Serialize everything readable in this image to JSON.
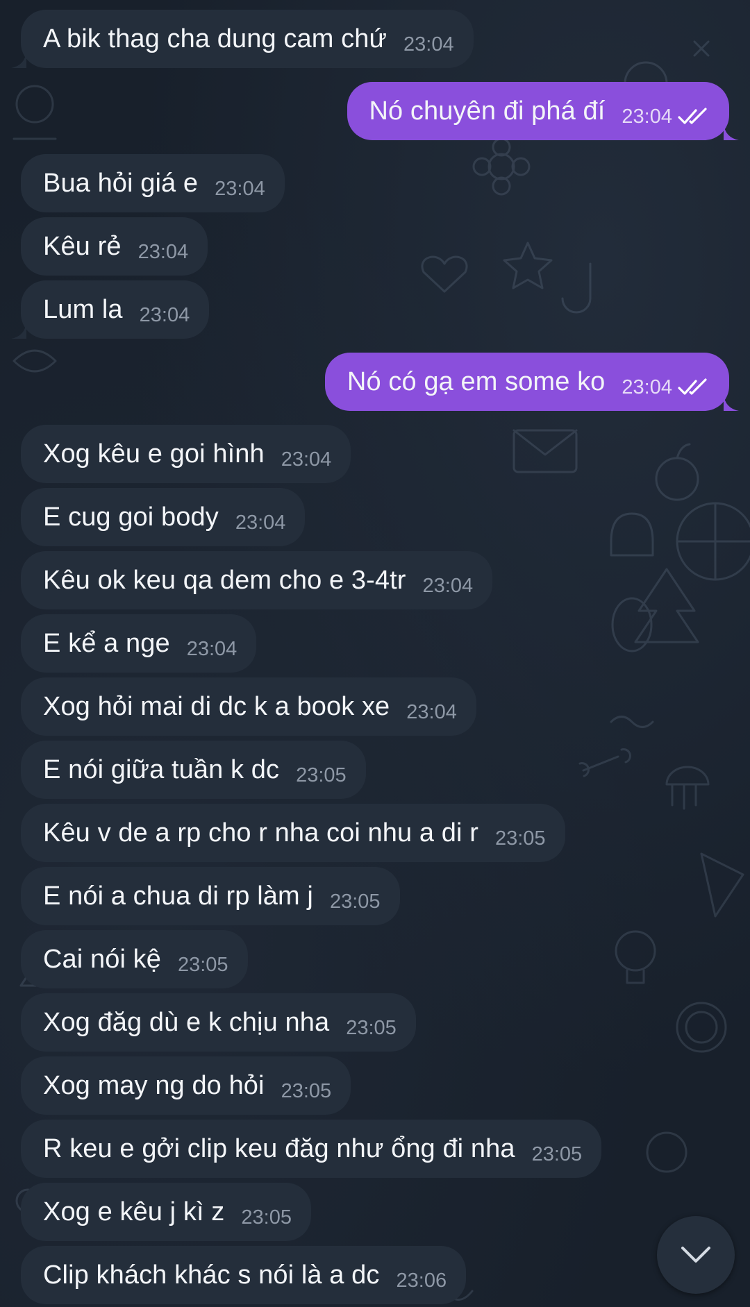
{
  "chat": {
    "messages": [
      {
        "dir": "in",
        "text": "A bik thag cha dung cam chứ",
        "time": "23:04",
        "tail": true
      },
      {
        "dir": "out",
        "text": "Nó chuyên đi phá đí",
        "time": "23:04",
        "read": true,
        "tail": true
      },
      {
        "dir": "in",
        "text": "Bua hỏi giá e",
        "time": "23:04",
        "tail": false
      },
      {
        "dir": "in",
        "text": "Kêu rẻ",
        "time": "23:04",
        "tail": false
      },
      {
        "dir": "in",
        "text": "Lum la",
        "time": "23:04",
        "tail": true
      },
      {
        "dir": "out",
        "text": "Nó có gạ em some ko",
        "time": "23:04",
        "read": true,
        "tail": true
      },
      {
        "dir": "in",
        "text": "Xog kêu e goi hình",
        "time": "23:04",
        "tail": false
      },
      {
        "dir": "in",
        "text": "E cug goi body",
        "time": "23:04",
        "tail": false
      },
      {
        "dir": "in",
        "text": "Kêu ok keu qa dem cho e 3-4tr",
        "time": "23:04",
        "tail": false
      },
      {
        "dir": "in",
        "text": "E kể a nge",
        "time": "23:04",
        "tail": false
      },
      {
        "dir": "in",
        "text": "Xog hỏi mai di dc k a book xe",
        "time": "23:04",
        "tail": false
      },
      {
        "dir": "in",
        "text": "E nói giữa tuần k dc",
        "time": "23:05",
        "tail": false
      },
      {
        "dir": "in",
        "text": "Kêu v de a rp cho r nha coi nhu a di r",
        "time": "23:05",
        "tail": false
      },
      {
        "dir": "in",
        "text": "E nói a chua di rp làm j",
        "time": "23:05",
        "tail": false
      },
      {
        "dir": "in",
        "text": "Cai nói kệ",
        "time": "23:05",
        "tail": false
      },
      {
        "dir": "in",
        "text": "Xog đăg dù e k chịu nha",
        "time": "23:05",
        "tail": false
      },
      {
        "dir": "in",
        "text": "Xog may ng do hỏi",
        "time": "23:05",
        "tail": false
      },
      {
        "dir": "in",
        "text": "R keu e gởi clip keu đăg như ổng đi nha",
        "time": "23:05",
        "tail": false
      },
      {
        "dir": "in",
        "text": "Xog e kêu j kì z",
        "time": "23:05",
        "tail": false
      },
      {
        "dir": "in",
        "text": "Clip khách khác s nói là a dc",
        "time": "23:06",
        "tail": false
      }
    ]
  },
  "colors": {
    "incoming_bubble": "#242e3b",
    "outgoing_bubble": "#8a4fdc",
    "background": "#18202b"
  },
  "scroll_button": {
    "icon": "chevron-down-icon"
  }
}
